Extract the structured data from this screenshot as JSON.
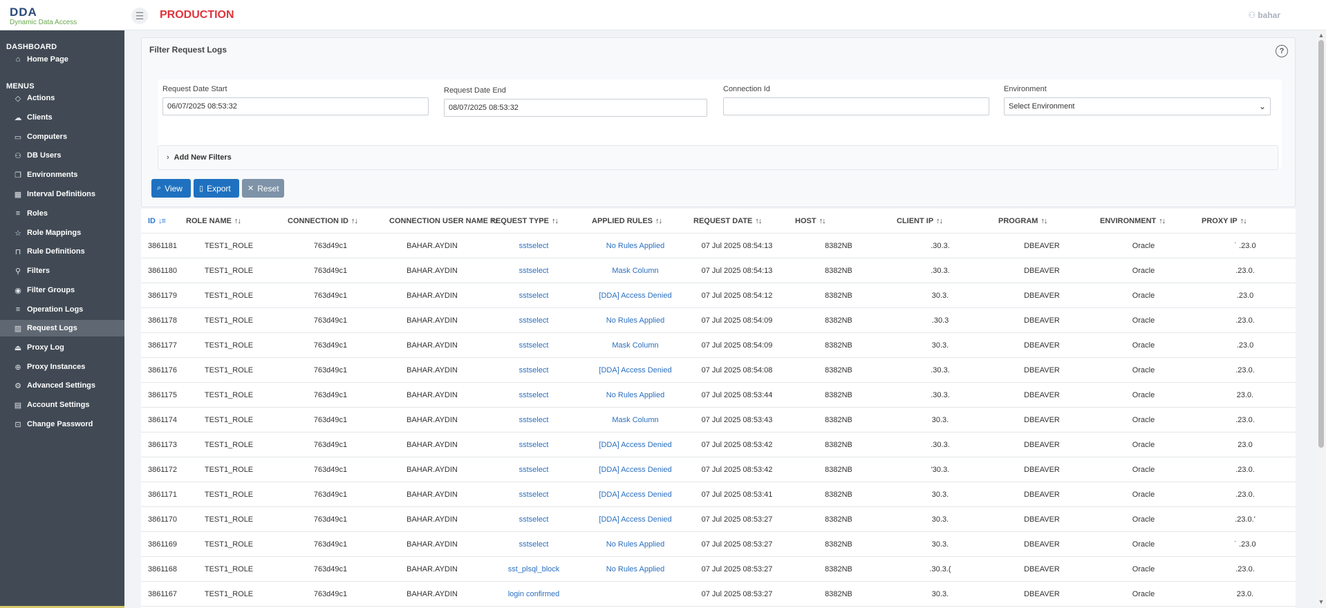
{
  "header": {
    "logo_mark": "DDA",
    "logo_sub": "Dynamic Data Access",
    "env": "PRODUCTION",
    "user": "bahar",
    "user_icon": "user-icon"
  },
  "sidebar": {
    "dashboard_head": "DASHBOARD",
    "menus_head": "MENUS",
    "items": [
      {
        "label": "Home Page",
        "icon": "home-icon",
        "glyph": "⌂"
      },
      {
        "label": "Actions",
        "icon": "tag-icon",
        "glyph": "◇"
      },
      {
        "label": "Clients",
        "icon": "cloud-icon",
        "glyph": "☁"
      },
      {
        "label": "Computers",
        "icon": "monitor-icon",
        "glyph": "▭"
      },
      {
        "label": "DB Users",
        "icon": "users-icon",
        "glyph": "⚇"
      },
      {
        "label": "Environments",
        "icon": "copy-icon",
        "glyph": "❐"
      },
      {
        "label": "Interval Definitions",
        "icon": "calendar-icon",
        "glyph": "▦"
      },
      {
        "label": "Roles",
        "icon": "list-icon",
        "glyph": "≡"
      },
      {
        "label": "Role Mappings",
        "icon": "star-icon",
        "glyph": "☆"
      },
      {
        "label": "Rule Definitions",
        "icon": "bookmark-icon",
        "glyph": "⊓"
      },
      {
        "label": "Filters",
        "icon": "sitemap-icon",
        "glyph": "⚲"
      },
      {
        "label": "Filter Groups",
        "icon": "eye-icon",
        "glyph": "◉"
      },
      {
        "label": "Operation Logs",
        "icon": "list-icon",
        "glyph": "≡"
      },
      {
        "label": "Request Logs",
        "icon": "chart-icon",
        "glyph": "▥"
      },
      {
        "label": "Proxy Log",
        "icon": "inbox-icon",
        "glyph": "⏏"
      },
      {
        "label": "Proxy Instances",
        "icon": "globe-icon",
        "glyph": "⊕"
      },
      {
        "label": "Advanced Settings",
        "icon": "gear-icon",
        "glyph": "⚙"
      },
      {
        "label": "Account Settings",
        "icon": "calendar-icon",
        "glyph": "▤"
      },
      {
        "label": "Change Password",
        "icon": "lock-icon",
        "glyph": "⊡"
      }
    ]
  },
  "filter": {
    "title": "Filter Request Logs",
    "help_icon": "question-icon",
    "start_label": "Request Date Start",
    "start_value": "06/07/2025 08:53:32",
    "end_label": "Request Date End",
    "end_value": "08/07/2025 08:53:32",
    "conn_label": "Connection Id",
    "conn_value": "",
    "env_label": "Environment",
    "env_value": "Select Environment",
    "add_filters": "Add New Filters",
    "view_label": "View",
    "export_label": "Export",
    "reset_label": "Reset"
  },
  "table": {
    "columns": [
      "ID",
      "ROLE NAME",
      "CONNECTION ID",
      "CONNECTION USER NAME",
      "REQUEST TYPE",
      "APPLIED RULES",
      "REQUEST DATE",
      "HOST",
      "CLIENT IP",
      "PROGRAM",
      "ENVIRONMENT",
      "PROXY IP"
    ],
    "rows": [
      {
        "id": "3861181",
        "role": "TEST1_ROLE",
        "conn": "763d49c1",
        "user": "BAHAR.AYDIN",
        "type": "sstselect",
        "rules": "No Rules Applied",
        "date": "07 Jul 2025 08:54:13",
        "host": "8382NB",
        "client": ".30.3.",
        "program": "DBEAVER",
        "env": "Oracle",
        "proxy": "˙ .23.0"
      },
      {
        "id": "3861180",
        "role": "TEST1_ROLE",
        "conn": "763d49c1",
        "user": "BAHAR.AYDIN",
        "type": "sstselect",
        "rules": "Mask Column",
        "date": "07 Jul 2025 08:54:13",
        "host": "8382NB",
        "client": ".30.3.",
        "program": "DBEAVER",
        "env": "Oracle",
        "proxy": ".23.0."
      },
      {
        "id": "3861179",
        "role": "TEST1_ROLE",
        "conn": "763d49c1",
        "user": "BAHAR.AYDIN",
        "type": "sstselect",
        "rules": "[DDA] Access Denied",
        "date": "07 Jul 2025 08:54:12",
        "host": "8382NB",
        "client": "30.3.",
        "program": "DBEAVER",
        "env": "Oracle",
        "proxy": ".23.0"
      },
      {
        "id": "3861178",
        "role": "TEST1_ROLE",
        "conn": "763d49c1",
        "user": "BAHAR.AYDIN",
        "type": "sstselect",
        "rules": "No Rules Applied",
        "date": "07 Jul 2025 08:54:09",
        "host": "8382NB",
        "client": ".30.3",
        "program": "DBEAVER",
        "env": "Oracle",
        "proxy": ".23.0."
      },
      {
        "id": "3861177",
        "role": "TEST1_ROLE",
        "conn": "763d49c1",
        "user": "BAHAR.AYDIN",
        "type": "sstselect",
        "rules": "Mask Column",
        "date": "07 Jul 2025 08:54:09",
        "host": "8382NB",
        "client": "30.3.",
        "program": "DBEAVER",
        "env": "Oracle",
        "proxy": ".23.0"
      },
      {
        "id": "3861176",
        "role": "TEST1_ROLE",
        "conn": "763d49c1",
        "user": "BAHAR.AYDIN",
        "type": "sstselect",
        "rules": "[DDA] Access Denied",
        "date": "07 Jul 2025 08:54:08",
        "host": "8382NB",
        "client": ".30.3.",
        "program": "DBEAVER",
        "env": "Oracle",
        "proxy": ".23.0."
      },
      {
        "id": "3861175",
        "role": "TEST1_ROLE",
        "conn": "763d49c1",
        "user": "BAHAR.AYDIN",
        "type": "sstselect",
        "rules": "No Rules Applied",
        "date": "07 Jul 2025 08:53:44",
        "host": "8382NB",
        "client": ".30.3.",
        "program": "DBEAVER",
        "env": "Oracle",
        "proxy": "23.0."
      },
      {
        "id": "3861174",
        "role": "TEST1_ROLE",
        "conn": "763d49c1",
        "user": "BAHAR.AYDIN",
        "type": "sstselect",
        "rules": "Mask Column",
        "date": "07 Jul 2025 08:53:43",
        "host": "8382NB",
        "client": "30.3.",
        "program": "DBEAVER",
        "env": "Oracle",
        "proxy": ".23.0."
      },
      {
        "id": "3861173",
        "role": "TEST1_ROLE",
        "conn": "763d49c1",
        "user": "BAHAR.AYDIN",
        "type": "sstselect",
        "rules": "[DDA] Access Denied",
        "date": "07 Jul 2025 08:53:42",
        "host": "8382NB",
        "client": ".30.3.",
        "program": "DBEAVER",
        "env": "Oracle",
        "proxy": "23.0"
      },
      {
        "id": "3861172",
        "role": "TEST1_ROLE",
        "conn": "763d49c1",
        "user": "BAHAR.AYDIN",
        "type": "sstselect",
        "rules": "[DDA] Access Denied",
        "date": "07 Jul 2025 08:53:42",
        "host": "8382NB",
        "client": "'30.3.",
        "program": "DBEAVER",
        "env": "Oracle",
        "proxy": ".23.0."
      },
      {
        "id": "3861171",
        "role": "TEST1_ROLE",
        "conn": "763d49c1",
        "user": "BAHAR.AYDIN",
        "type": "sstselect",
        "rules": "[DDA] Access Denied",
        "date": "07 Jul 2025 08:53:41",
        "host": "8382NB",
        "client": "30.3.",
        "program": "DBEAVER",
        "env": "Oracle",
        "proxy": ".23.0."
      },
      {
        "id": "3861170",
        "role": "TEST1_ROLE",
        "conn": "763d49c1",
        "user": "BAHAR.AYDIN",
        "type": "sstselect",
        "rules": "[DDA] Access Denied",
        "date": "07 Jul 2025 08:53:27",
        "host": "8382NB",
        "client": "30.3.",
        "program": "DBEAVER",
        "env": "Oracle",
        "proxy": ".23.0.'"
      },
      {
        "id": "3861169",
        "role": "TEST1_ROLE",
        "conn": "763d49c1",
        "user": "BAHAR.AYDIN",
        "type": "sstselect",
        "rules": "No Rules Applied",
        "date": "07 Jul 2025 08:53:27",
        "host": "8382NB",
        "client": "30.3.",
        "program": "DBEAVER",
        "env": "Oracle",
        "proxy": "˙ .23.0"
      },
      {
        "id": "3861168",
        "role": "TEST1_ROLE",
        "conn": "763d49c1",
        "user": "BAHAR.AYDIN",
        "type": "sst_plsql_block",
        "rules": "No Rules Applied",
        "date": "07 Jul 2025 08:53:27",
        "host": "8382NB",
        "client": ".30.3.(",
        "program": "DBEAVER",
        "env": "Oracle",
        "proxy": ".23.0."
      },
      {
        "id": "3861167",
        "role": "TEST1_ROLE",
        "conn": "763d49c1",
        "user": "BAHAR.AYDIN",
        "type": "login confirmed",
        "rules": "",
        "date": "07 Jul 2025 08:53:27",
        "host": "8382NB",
        "client": "30.3.",
        "program": "DBEAVER",
        "env": "Oracle",
        "proxy": "23.0."
      }
    ]
  }
}
